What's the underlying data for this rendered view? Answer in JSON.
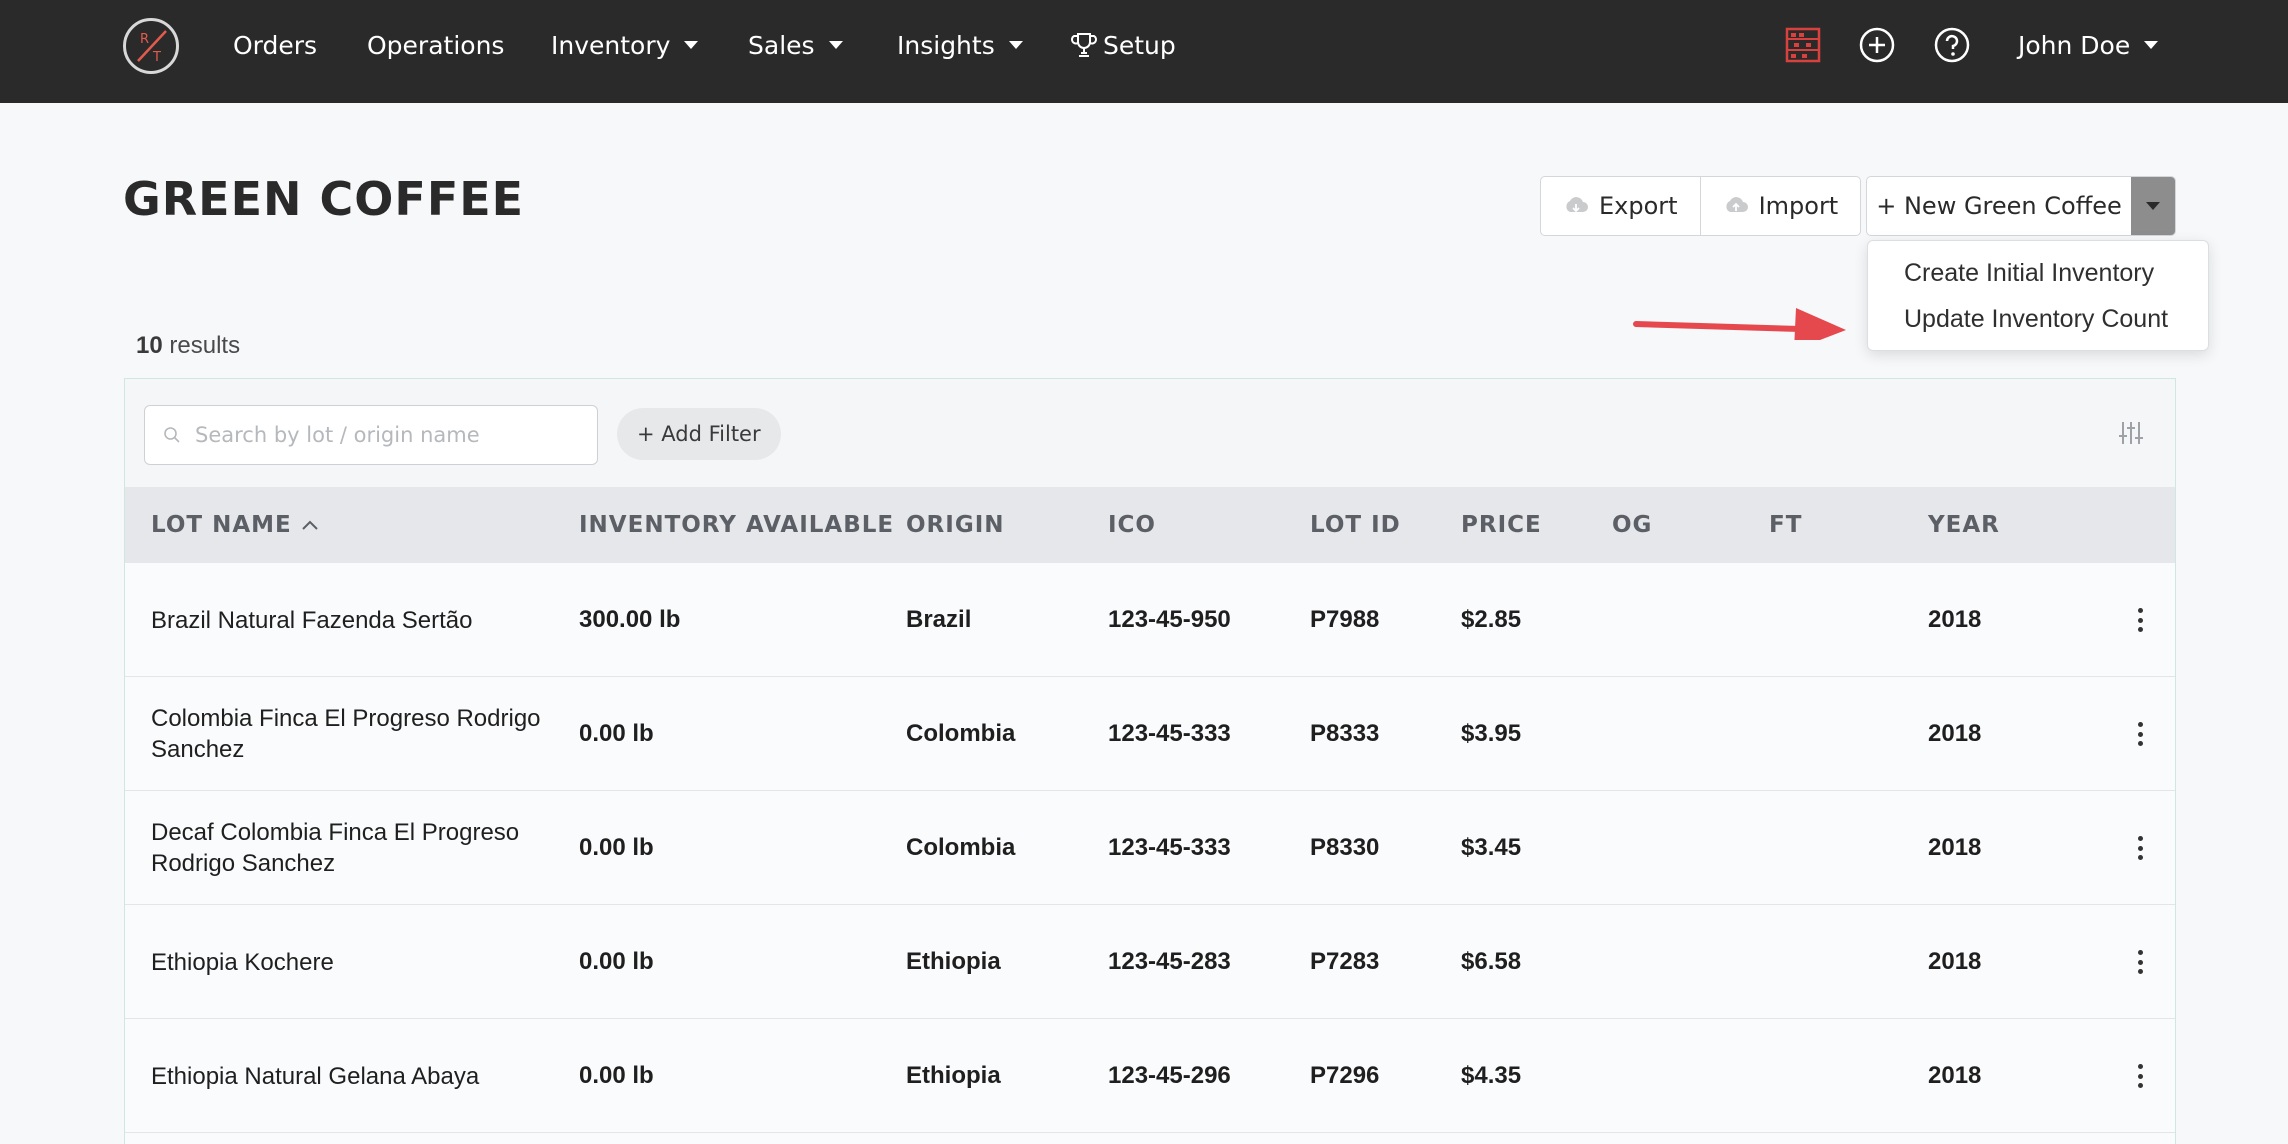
{
  "nav": {
    "logo_letters": [
      "R",
      "T"
    ],
    "items": [
      {
        "label": "Orders",
        "has_caret": false
      },
      {
        "label": "Operations",
        "has_caret": false
      },
      {
        "label": "Inventory",
        "has_caret": true
      },
      {
        "label": "Sales",
        "has_caret": true
      },
      {
        "label": "Insights",
        "has_caret": true
      },
      {
        "label": "Setup",
        "icon": "trophy-icon"
      }
    ],
    "right_icons": [
      "abacus-icon",
      "plus-circle-icon",
      "help-circle-icon"
    ],
    "user": "John Doe"
  },
  "page": {
    "title": "GREEN COFFEE",
    "export_label": "Export",
    "import_label": "Import",
    "new_label": "+ New Green Coffee",
    "dropdown": [
      "Create Initial Inventory",
      "Update Inventory Count"
    ],
    "results_count": "10",
    "results_label": "results"
  },
  "search": {
    "placeholder": "Search by lot / origin name",
    "add_filter_label": "+ Add Filter"
  },
  "table": {
    "columns": [
      "LOT NAME",
      "INVENTORY AVAILABLE",
      "ORIGIN",
      "ICO",
      "LOT ID",
      "PRICE",
      "OG",
      "FT",
      "YEAR"
    ],
    "rows": [
      {
        "name": "Brazil Natural Fazenda Sertão",
        "inventory": "300.00 lb",
        "origin": "Brazil",
        "ico": "123-45-950",
        "lot_id": "P7988",
        "price": "$2.85",
        "og": "",
        "ft": "",
        "year": "2018"
      },
      {
        "name": "Colombia Finca El Progreso Rodrigo Sanchez",
        "inventory": "0.00 lb",
        "origin": "Colombia",
        "ico": "123-45-333",
        "lot_id": "P8333",
        "price": "$3.95",
        "og": "",
        "ft": "",
        "year": "2018"
      },
      {
        "name": "Decaf Colombia Finca El Progreso Rodrigo Sanchez",
        "inventory": "0.00 lb",
        "origin": "Colombia",
        "ico": "123-45-333",
        "lot_id": "P8330",
        "price": "$3.45",
        "og": "",
        "ft": "",
        "year": "2018"
      },
      {
        "name": "Ethiopia Kochere",
        "inventory": "0.00 lb",
        "origin": "Ethiopia",
        "ico": "123-45-283",
        "lot_id": "P7283",
        "price": "$6.58",
        "og": "",
        "ft": "",
        "year": "2018"
      },
      {
        "name": "Ethiopia Natural Gelana Abaya",
        "inventory": "0.00 lb",
        "origin": "Ethiopia",
        "ico": "123-45-296",
        "lot_id": "P7296",
        "price": "$4.35",
        "og": "",
        "ft": "",
        "year": "2018"
      }
    ]
  },
  "colors": {
    "nav_bg": "#2b2a2a",
    "accent_red": "#e5484d",
    "split_button": "#8d8d8d"
  }
}
